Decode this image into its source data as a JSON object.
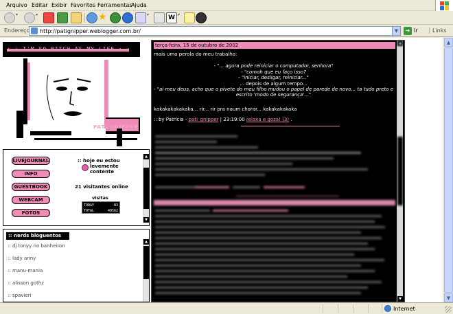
{
  "menu": [
    "Arquivo",
    "Editar",
    "Exibir",
    "Favoritos",
    "Ferramentas",
    "Ajuda"
  ],
  "address": {
    "label": "Endereço",
    "url": "http://patignipper.weblogger.com.br/",
    "go_label": "Ir",
    "links_label": "Links"
  },
  "logo": {
    "title": ": : I'M SO BITCH AS MY LIFE : :",
    "signature": "PATI GNIPPER"
  },
  "nav": {
    "buttons": [
      "LIVEJOURNAL",
      "INFO",
      "GUESTBOOK",
      "WEBCAM",
      "FOTOS"
    ]
  },
  "mood": {
    "title": ":: hoje eu estou",
    "line1": "levemente",
    "line2": "contente"
  },
  "visitors": "21 visitantes online",
  "counter": {
    "label": "visitas",
    "today_label": "TODAY",
    "today_value": "83",
    "total_label": "TOTAL",
    "total_value": "40562"
  },
  "blogroll": {
    "header": ":: nerds bloguentos",
    "items": [
      ":: dj tonyy no banheiron",
      ":: lady anny",
      ":: manu-mania",
      ":: alisson gothz",
      ":: spavieri"
    ]
  },
  "post": {
    "date": "terça-feira, 15 de outubro de 2002",
    "intro": "mais uma perola do meu trabalho:",
    "quote": [
      "- \"... agora pode reiniciar o computador, senhora\"",
      "- \"comoh que eu faço isso?",
      "- \"iniciar, desligar, reiniciar...\"",
      "... depois de algum tempo...",
      "- \"ai meu deus, acho que o pivete do meu filho mudou o papel de parede de novo... ta tudo preto e",
      "escrito 'modo de segurança'...\""
    ],
    "laugh": "kakakakakakaka... rir... rir pra naum chorar... kakakakakaka",
    "footer_prefix": ":: by Patrícia -",
    "author": "pati_gnipper",
    "time": "| 23:19:00",
    "comments": "relaxa e goza! (3)",
    "footer_suffix": "."
  },
  "status": {
    "zone": "Internet"
  },
  "colors": {
    "accent_pink": "#f08bb8",
    "post_bg": "#000000"
  }
}
